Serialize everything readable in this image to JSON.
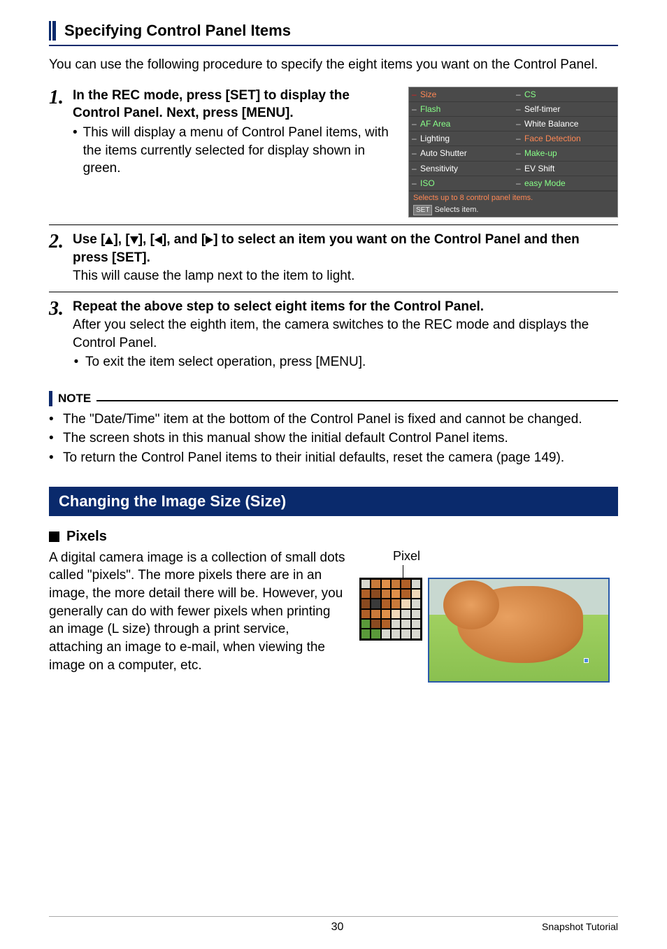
{
  "section1": {
    "title": "Specifying Control Panel Items",
    "intro": "You can use the following procedure to specify the eight items you want on the Control Panel."
  },
  "steps": {
    "s1": {
      "num": "1.",
      "title": "In the REC mode, press [SET] to display the Control Panel. Next, press [MENU].",
      "bullet": "This will display a menu of Control Panel items, with the items currently selected for display shown in green."
    },
    "s2": {
      "num": "2.",
      "title_a": "Use [",
      "title_b": "], [",
      "title_c": "], [",
      "title_d": "], and [",
      "title_e": "] to select an item you want on the Control Panel and then press [SET].",
      "desc": "This will cause the lamp next to the item to light."
    },
    "s3": {
      "num": "3.",
      "title": "Repeat the above step to select eight items for the Control Panel.",
      "desc": "After you select the eighth item, the camera switches to the REC mode and displays the Control Panel.",
      "bullet": "To exit the item select operation, press [MENU]."
    }
  },
  "panel": {
    "items_left": [
      "Size",
      "Flash",
      "AF Area",
      "Lighting",
      "Auto Shutter",
      "Sensitivity",
      "ISO"
    ],
    "items_right": [
      "CS",
      "Self-timer",
      "White Balance",
      "Face Detection",
      "Make-up",
      "EV Shift",
      "easy Mode"
    ],
    "left_green": [
      true,
      true,
      true,
      false,
      false,
      false,
      true
    ],
    "right_green": [
      true,
      false,
      false,
      true,
      true,
      false,
      true
    ],
    "left_tick_red": [
      true,
      false,
      false,
      false,
      false,
      false,
      false
    ],
    "footer1": "Selects up to 8 control panel items.",
    "footer2_btn": "SET",
    "footer2_txt": "Selects item."
  },
  "note": {
    "label": "NOTE",
    "n1": "The \"Date/Time\" item at the bottom of the Control Panel is fixed and cannot be changed.",
    "n2": "The screen shots in this manual show the initial default Control Panel items.",
    "n3": "To return the Control Panel items to their initial defaults, reset the camera (page 149)."
  },
  "darkbar": "Changing the Image Size (Size)",
  "pixels": {
    "heading": "Pixels",
    "label": "Pixel",
    "text": "A digital camera image is a collection of small dots called \"pixels\". The more pixels there are in an image, the more detail there will be. However, you generally can do with fewer pixels when printing an image (L size) through a print service, attaching an image to e-mail, when viewing the image on a computer, etc."
  },
  "footer": {
    "page": "30",
    "section": "Snapshot Tutorial"
  }
}
